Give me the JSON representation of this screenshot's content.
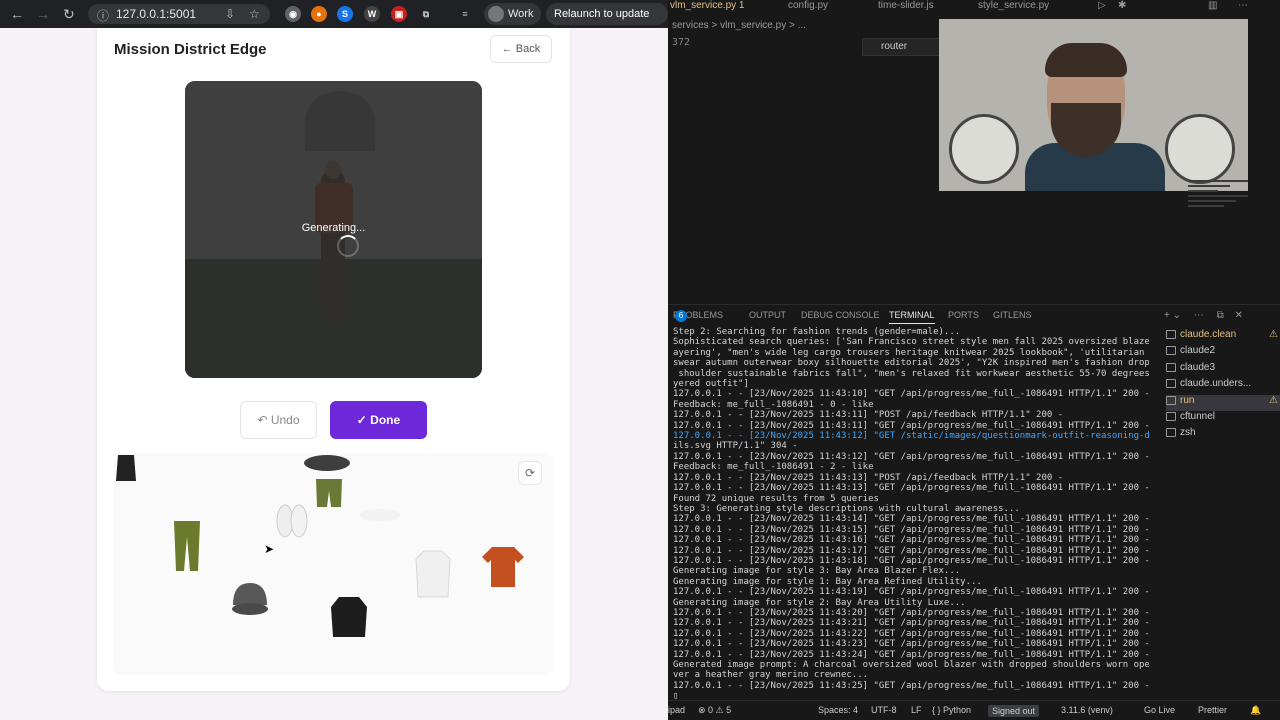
{
  "browser": {
    "url": "127.0.0.1:5001",
    "profile": "Work",
    "relaunch": "Relaunch to update",
    "menu": "⋮"
  },
  "page": {
    "title": "Mission District Edge",
    "back": "← Back",
    "generating": "Generating...",
    "undo": "↶ Undo",
    "done": "✓ Done",
    "refresh": "⟳"
  },
  "editor": {
    "tabs": [
      "vlm_service.py 1",
      "config.py",
      "time-slider.js",
      "style_service.py"
    ],
    "breadcrumb": "services  >  vlm_service.py  >  ...",
    "line_number": "372",
    "router": "router"
  },
  "panel": {
    "tabs": [
      "PROBLEMS",
      "OUTPUT",
      "DEBUG CONSOLE",
      "TERMINAL",
      "PORTS",
      "GITLENS"
    ],
    "problems_count": "6",
    "active_tab": "TERMINAL",
    "terminal_lines": [
      "Step 2: Searching for fashion trends (gender=male)...",
      "Sophisticated search queries: ['San Francisco street style men fall 2025 oversized blazer l",
      "ayering', \"men's wide leg cargo trousers heritage knitwear 2025 lookbook\", 'utilitarian men",
      "swear autumn outerwear boxy silhouette editorial 2025', \"Y2K inspired men's fashion dropped",
      " shoulder sustainable fabrics fall\", \"men's relaxed fit workwear aesthetic 55-70 degrees la",
      "yered outfit\"]",
      "127.0.0.1 - - [23/Nov/2025 11:43:10] \"GET /api/progress/me_full_-1086491 HTTP/1.1\" 200 -",
      "Feedback: me_full_-1086491 - 0 - like",
      "127.0.0.1 - - [23/Nov/2025 11:43:11] \"POST /api/feedback HTTP/1.1\" 200 -",
      "127.0.0.1 - - [23/Nov/2025 11:43:11] \"GET /api/progress/me_full_-1086491 HTTP/1.1\" 200 -",
      "127.0.0.1 - - [23/Nov/2025 11:43:12] \"GET /static/images/questionmark-outfit-reasoning-deta",
      "ils.svg HTTP/1.1\" 304 -",
      "127.0.0.1 - - [23/Nov/2025 11:43:12] \"GET /api/progress/me_full_-1086491 HTTP/1.1\" 200 -",
      "Feedback: me_full_-1086491 - 2 - like",
      "127.0.0.1 - - [23/Nov/2025 11:43:13] \"POST /api/feedback HTTP/1.1\" 200 -",
      "127.0.0.1 - - [23/Nov/2025 11:43:13] \"GET /api/progress/me_full_-1086491 HTTP/1.1\" 200 -",
      "Found 72 unique results from 5 queries",
      "Step 3: Generating style descriptions with cultural awareness...",
      "127.0.0.1 - - [23/Nov/2025 11:43:14] \"GET /api/progress/me_full_-1086491 HTTP/1.1\" 200 -",
      "127.0.0.1 - - [23/Nov/2025 11:43:15] \"GET /api/progress/me_full_-1086491 HTTP/1.1\" 200 -",
      "127.0.0.1 - - [23/Nov/2025 11:43:16] \"GET /api/progress/me_full_-1086491 HTTP/1.1\" 200 -",
      "127.0.0.1 - - [23/Nov/2025 11:43:17] \"GET /api/progress/me_full_-1086491 HTTP/1.1\" 200 -",
      "127.0.0.1 - - [23/Nov/2025 11:43:18] \"GET /api/progress/me_full_-1086491 HTTP/1.1\" 200 -",
      "Generating image for style 3: Bay Area Blazer Flex...",
      "Generating image for style 1: Bay Area Refined Utility...",
      "127.0.0.1 - - [23/Nov/2025 11:43:19] \"GET /api/progress/me_full_-1086491 HTTP/1.1\" 200 -",
      "Generating image for style 2: Bay Area Utility Luxe...",
      "127.0.0.1 - - [23/Nov/2025 11:43:20] \"GET /api/progress/me_full_-1086491 HTTP/1.1\" 200 -",
      "127.0.0.1 - - [23/Nov/2025 11:43:21] \"GET /api/progress/me_full_-1086491 HTTP/1.1\" 200 -",
      "127.0.0.1 - - [23/Nov/2025 11:43:22] \"GET /api/progress/me_full_-1086491 HTTP/1.1\" 200 -",
      "127.0.0.1 - - [23/Nov/2025 11:43:23] \"GET /api/progress/me_full_-1086491 HTTP/1.1\" 200 -",
      "127.0.0.1 - - [23/Nov/2025 11:43:24] \"GET /api/progress/me_full_-1086491 HTTP/1.1\" 200 -",
      "Generated image prompt: A charcoal oversized wool blazer with dropped shoulders worn open o",
      "ver a heather gray merino crewnec...",
      "127.0.0.1 - - [23/Nov/2025 11:43:25] \"GET /api/progress/me_full_-1086491 HTTP/1.1\" 200 -",
      "▯"
    ],
    "terminals": [
      {
        "name": "claude.clean",
        "warn": true
      },
      {
        "name": "claude2",
        "warn": false
      },
      {
        "name": "claude3",
        "warn": false
      },
      {
        "name": "claude.unders...",
        "warn": false
      },
      {
        "name": "run",
        "warn": true
      },
      {
        "name": "cftunnel",
        "warn": false
      },
      {
        "name": "zsh",
        "warn": false
      }
    ]
  },
  "statusbar": {
    "left": "ipad",
    "problems": "⊗ 0 ⚠ 5",
    "spaces": "Spaces: 4",
    "encoding": "UTF-8",
    "eol": "LF",
    "language": "{ } Python",
    "signed": "Signed out",
    "python": "3.11.6 (venv)",
    "golive": "Go Live",
    "prettier": "Prettier"
  },
  "colors": {
    "accent": "#6d28d9",
    "terminal_bg": "#181818",
    "page_bg": "#f7f2f8"
  }
}
